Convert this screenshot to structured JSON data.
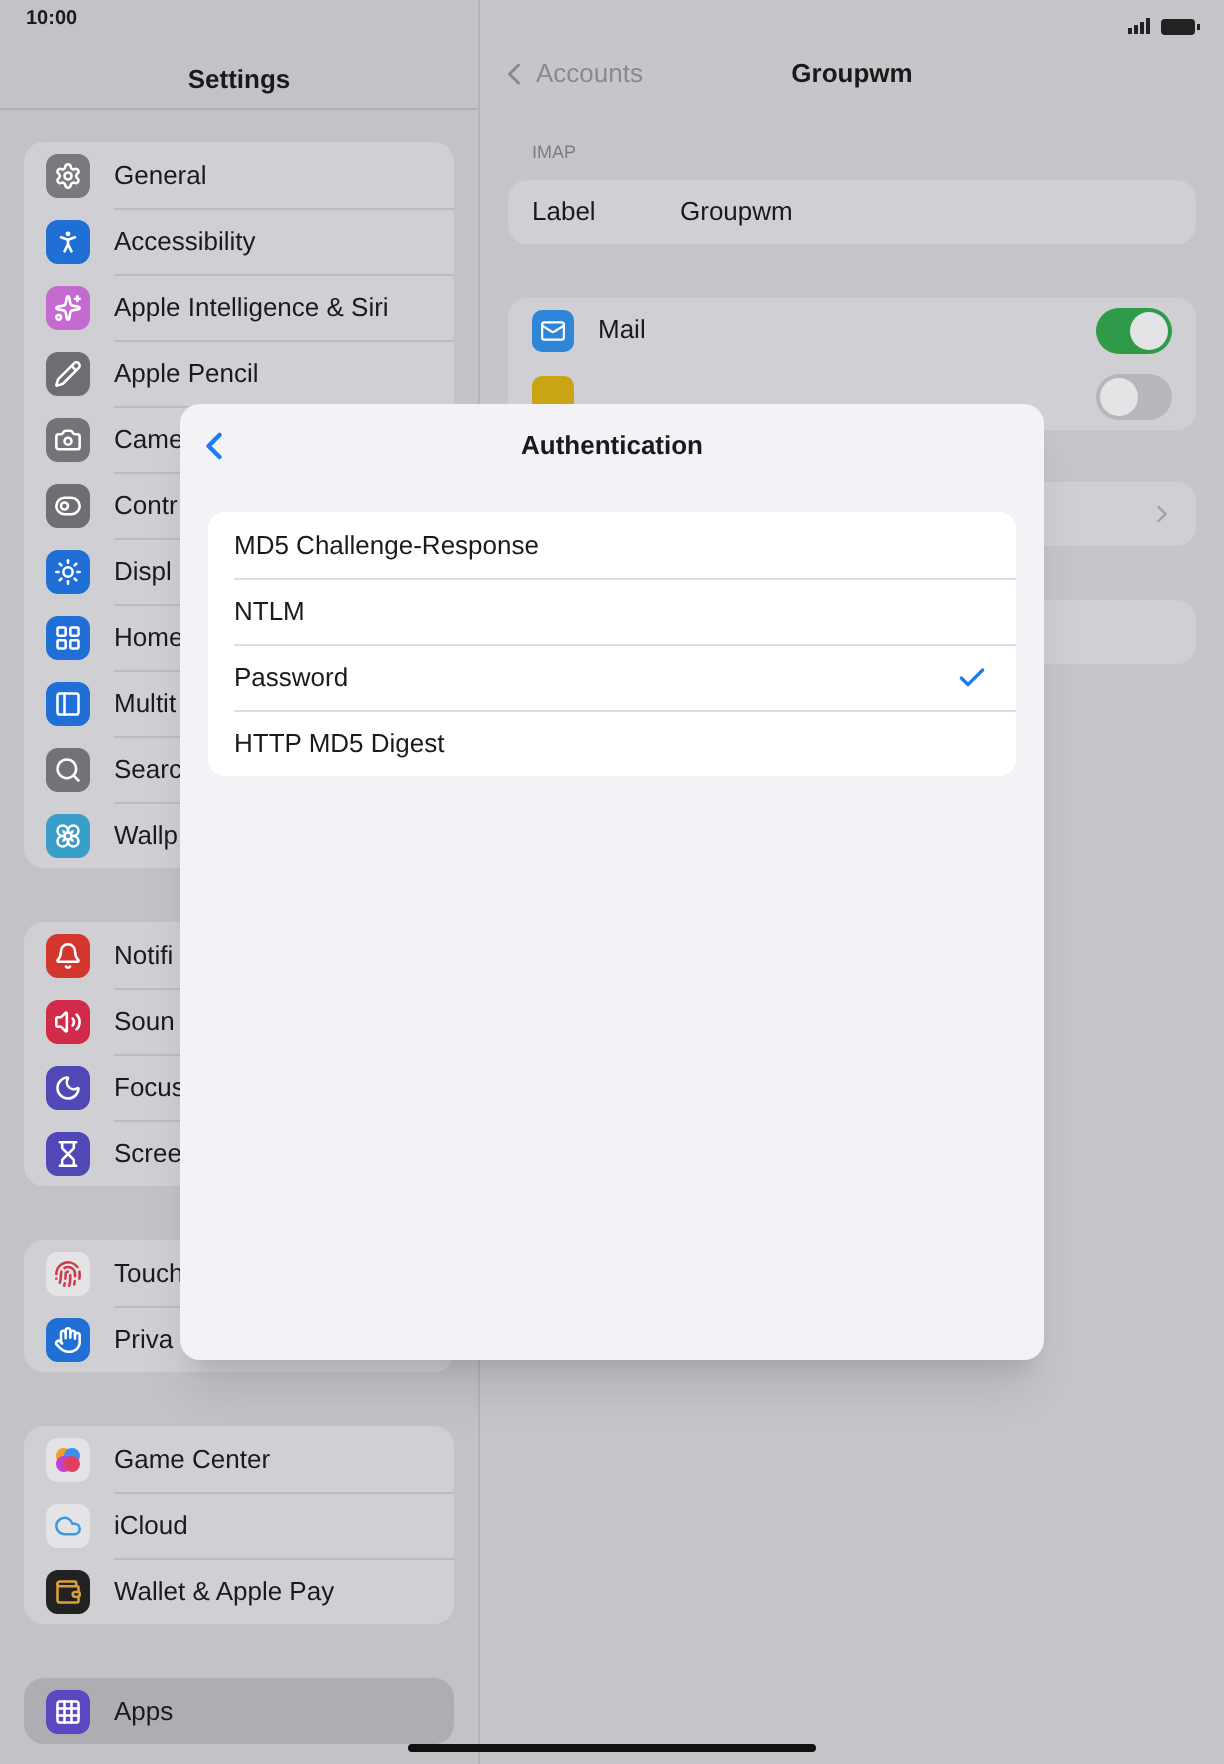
{
  "status_bar": {
    "time": "10:00"
  },
  "sidebar": {
    "title": "Settings",
    "groups": [
      [
        {
          "label": "General",
          "color": "#7a7a7e",
          "selected": false
        },
        {
          "label": "Accessibility",
          "color": "#1f6fd6",
          "selected": false
        },
        {
          "label": "Apple Intelligence & Siri",
          "color": "#c56ad0",
          "selected": false
        },
        {
          "label": "Apple Pencil",
          "color": "#6e6e72",
          "selected": false
        },
        {
          "label": "Came",
          "color": "#747478",
          "selected": false
        },
        {
          "label": "Contr",
          "color": "#6e6e72",
          "selected": false
        },
        {
          "label": "Displ",
          "color": "#1f6fd6",
          "selected": false
        },
        {
          "label": "Home",
          "color": "#1f6fd6",
          "selected": false
        },
        {
          "label": "Multit",
          "color": "#1f6fd6",
          "selected": false
        },
        {
          "label": "Searc",
          "color": "#737377",
          "selected": false
        },
        {
          "label": "Wallp",
          "color": "#3a9fc8",
          "selected": false
        }
      ],
      [
        {
          "label": "Notifi",
          "color": "#d2362c",
          "selected": false
        },
        {
          "label": "Soun",
          "color": "#d22a4a",
          "selected": false
        },
        {
          "label": "Focus",
          "color": "#5148b8",
          "selected": false
        },
        {
          "label": "Scree",
          "color": "#5148b8",
          "selected": false
        }
      ],
      [
        {
          "label": "Touch",
          "color": "#e4e4e6",
          "selected": false
        },
        {
          "label": "Priva",
          "color": "#1f6fd6",
          "selected": false
        }
      ],
      [
        {
          "label": "Game Center",
          "color": "#e4e4e6",
          "selected": false
        },
        {
          "label": "iCloud",
          "color": "#e4e4e6",
          "selected": false
        },
        {
          "label": "Wallet & Apple Pay",
          "color": "#222222",
          "selected": false
        }
      ],
      [
        {
          "label": "Apps",
          "color": "#5a48c0",
          "selected": true
        }
      ]
    ]
  },
  "detail": {
    "back": "Accounts",
    "title": "Groupwm",
    "section_header": "IMAP",
    "label_row": {
      "label": "Label",
      "value": "Groupwm"
    },
    "app_rows": [
      {
        "label": "Mail",
        "color": "#2f86d8",
        "on": true
      },
      {
        "color": "#c9a516",
        "on": false
      }
    ]
  },
  "modal": {
    "title": "Authentication",
    "options": [
      {
        "label": "MD5 Challenge-Response",
        "selected": false
      },
      {
        "label": "NTLM",
        "selected": false
      },
      {
        "label": "Password",
        "selected": true
      },
      {
        "label": "HTTP MD5 Digest",
        "selected": false
      }
    ]
  }
}
